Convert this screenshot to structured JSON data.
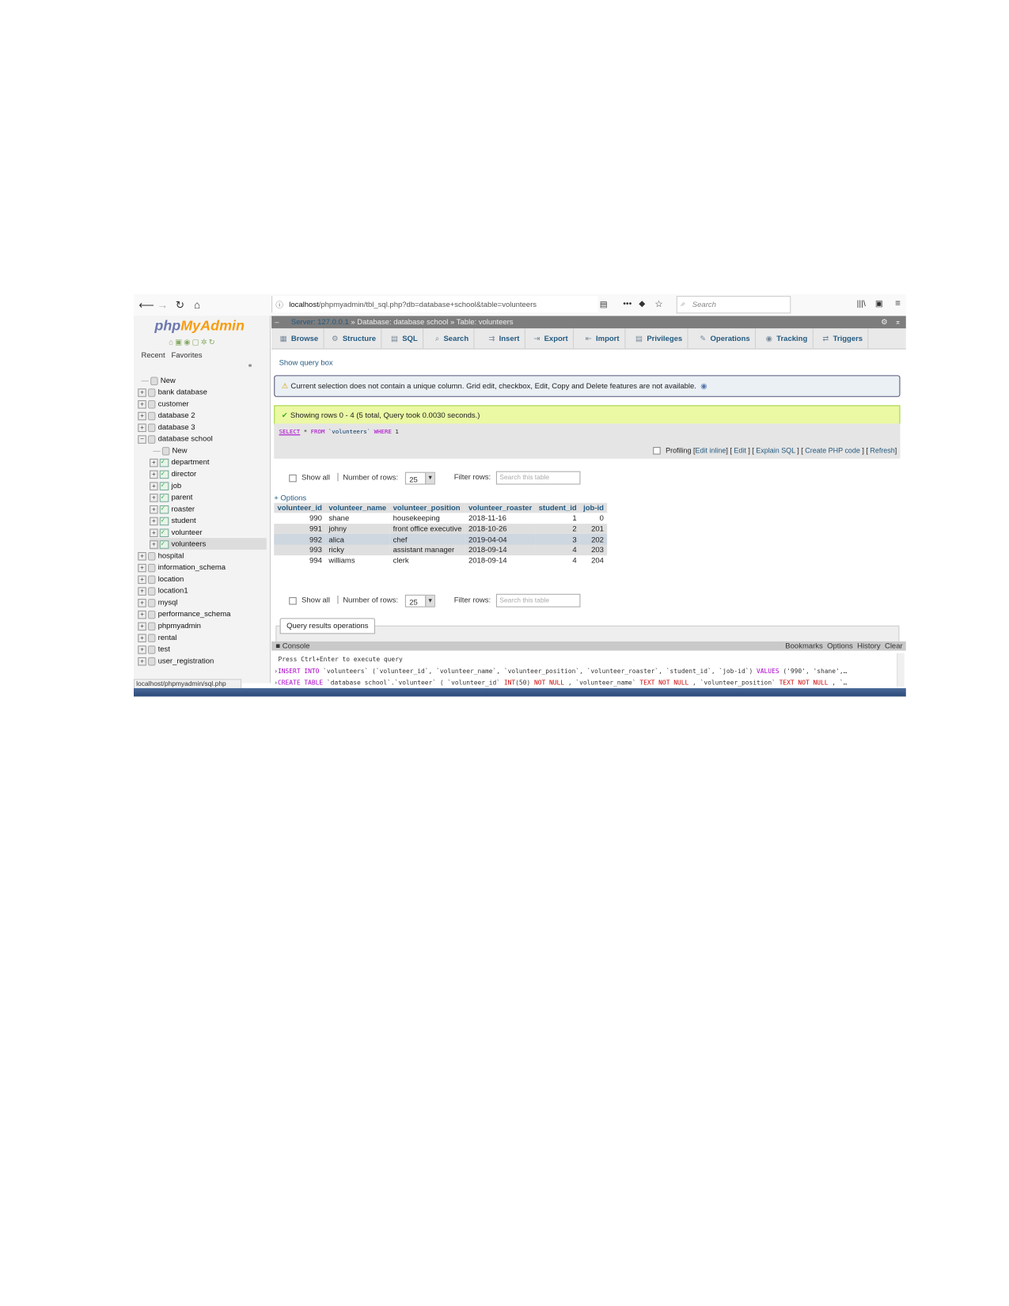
{
  "browser": {
    "url_host": "localhost",
    "url_path": "/phpmyadmin/tbl_sql.php?db=database+school&table=volunteers",
    "search_placeholder": "Search"
  },
  "sidebar": {
    "logo": "phpMyAdmin",
    "logo_a": "php",
    "logo_b": "MyAdmin",
    "recent": "Recent",
    "favorites": "Favorites",
    "items": [
      {
        "label": "New",
        "type": "new",
        "indent": 0
      },
      {
        "label": "bank database",
        "type": "db",
        "indent": 0
      },
      {
        "label": "customer",
        "type": "db",
        "indent": 0
      },
      {
        "label": "database 2",
        "type": "db",
        "indent": 0
      },
      {
        "label": "database 3",
        "type": "db",
        "indent": 0
      },
      {
        "label": "database school",
        "type": "db-open",
        "indent": 0
      },
      {
        "label": "New",
        "type": "new",
        "indent": 1
      },
      {
        "label": "department",
        "type": "table",
        "indent": 1
      },
      {
        "label": "director",
        "type": "table",
        "indent": 1
      },
      {
        "label": "job",
        "type": "table",
        "indent": 1
      },
      {
        "label": "parent",
        "type": "table",
        "indent": 1
      },
      {
        "label": "roaster",
        "type": "table",
        "indent": 1
      },
      {
        "label": "student",
        "type": "table",
        "indent": 1
      },
      {
        "label": "volunteer",
        "type": "table",
        "indent": 1
      },
      {
        "label": "volunteers",
        "type": "table",
        "indent": 1,
        "selected": true
      },
      {
        "label": "hospital",
        "type": "db",
        "indent": 0
      },
      {
        "label": "information_schema",
        "type": "db",
        "indent": 0
      },
      {
        "label": "location",
        "type": "db",
        "indent": 0
      },
      {
        "label": "location1",
        "type": "db",
        "indent": 0
      },
      {
        "label": "mysql",
        "type": "db",
        "indent": 0
      },
      {
        "label": "performance_schema",
        "type": "db",
        "indent": 0
      },
      {
        "label": "phpmyadmin",
        "type": "db",
        "indent": 0
      },
      {
        "label": "rental",
        "type": "db",
        "indent": 0
      },
      {
        "label": "test",
        "type": "db",
        "indent": 0
      },
      {
        "label": "user_registration",
        "type": "db",
        "indent": 0
      }
    ]
  },
  "status_bar": "localhost/phpmyadmin/sql.php",
  "breadcrumb": {
    "server": "Server: 127.0.0.1",
    "database": "Database: database school",
    "table": "Table: volunteers"
  },
  "tabs": [
    "Browse",
    "Structure",
    "SQL",
    "Search",
    "Insert",
    "Export",
    "Import",
    "Privileges",
    "Operations",
    "Tracking",
    "Triggers"
  ],
  "show_query_box": "Show query box",
  "warning": "Current selection does not contain a unique column. Grid edit, checkbox, Edit, Copy and Delete features are not available.",
  "success": "Showing rows 0 - 4 (5 total, Query took 0.0030 seconds.)",
  "sql": {
    "select": "SELECT",
    "star": " * ",
    "from": "FROM",
    "table": " `volunteers` ",
    "where": "WHERE",
    "cond": " 1"
  },
  "profiling": {
    "label": "Profiling",
    "edit_inline": "Edit inline",
    "edit": "Edit",
    "explain": "Explain SQL",
    "php": "Create PHP code",
    "refresh": "Refresh"
  },
  "controls": {
    "show_all": "Show all",
    "num_rows_label": "Number of rows:",
    "num_rows": "25",
    "filter_label": "Filter rows:",
    "filter_placeholder": "Search this table"
  },
  "options": "+ Options",
  "table": {
    "columns": [
      "volunteer_id",
      "volunteer_name",
      "volunteer_position",
      "volunteer_roaster",
      "student_id",
      "job-id"
    ],
    "rows": [
      [
        "990",
        "shane",
        "housekeeping",
        "2018-11-16",
        "1",
        "0"
      ],
      [
        "991",
        "johny",
        "front office executive",
        "2018-10-26",
        "2",
        "201"
      ],
      [
        "992",
        "alica",
        "chef",
        "2019-04-04",
        "3",
        "202"
      ],
      [
        "993",
        "ricky",
        "assistant manager",
        "2018-09-14",
        "4",
        "203"
      ],
      [
        "994",
        "williams",
        "clerk",
        "2018-09-14",
        "4",
        "204"
      ]
    ]
  },
  "query_results_operations": "Query results operations",
  "console": {
    "title": "Console",
    "bookmarks": "Bookmarks",
    "options": "Options",
    "history": "History",
    "clear": "Clear",
    "hint": "Press Ctrl+Enter to execute query",
    "line1": "INSERT INTO `volunteers` (`volunteer_id`, `volunteer_name`, `volunteer_position`, `volunteer_roaster`, `student_id`, `job-id`) VALUES ('990', 'shane',…",
    "line2": "CREATE TABLE `database school`.`volunteer` ( `volunteer_id` INT(50) NOT NULL , `volunteer_name` TEXT NOT NULL , `volunteer_position` TEXT NOT NULL , `…"
  }
}
